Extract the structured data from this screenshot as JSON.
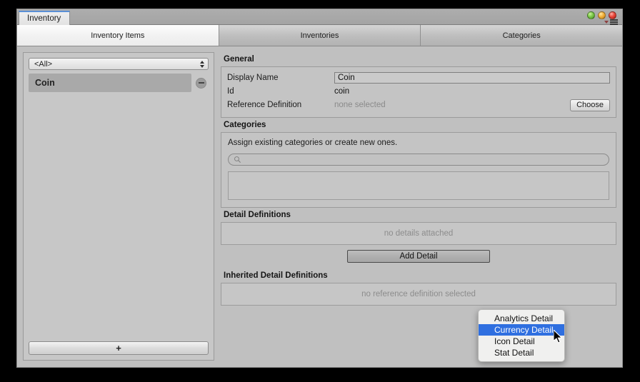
{
  "window": {
    "document_tab": "Inventory",
    "lights": [
      "green",
      "yellow",
      "red"
    ],
    "menu_icon": "hamburger-menu-icon"
  },
  "tabs": [
    {
      "label": "Inventory Items",
      "active": true
    },
    {
      "label": "Inventories",
      "active": false
    },
    {
      "label": "Categories",
      "active": false
    }
  ],
  "left_panel": {
    "filter": {
      "value": "<All>",
      "icon": "spin-arrows-icon"
    },
    "items": [
      {
        "label": "Coin",
        "selected": true,
        "remove_icon": "minus-circle-icon"
      }
    ],
    "add_button": "+"
  },
  "general": {
    "heading": "General",
    "display_name_label": "Display Name",
    "display_name_value": "Coin",
    "id_label": "Id",
    "id_value": "coin",
    "reference_definition_label": "Reference Definition",
    "reference_definition_value": "none selected",
    "choose_button": "Choose"
  },
  "categories": {
    "heading": "Categories",
    "hint": "Assign existing categories or create new ones.",
    "search_placeholder": "",
    "search_value": "",
    "search_icon": "search-icon",
    "assigned": []
  },
  "detail_definitions": {
    "heading": "Detail Definitions",
    "empty_text": "no details attached",
    "add_button": "Add Detail"
  },
  "inherited_detail_definitions": {
    "heading": "Inherited Detail Definitions",
    "empty_text": "no reference definition selected"
  },
  "popup_menu": {
    "items": [
      {
        "label": "Analytics Detail",
        "selected": false
      },
      {
        "label": "Currency Detail",
        "selected": true
      },
      {
        "label": "Icon Detail",
        "selected": false
      },
      {
        "label": "Stat Detail",
        "selected": false
      }
    ],
    "highlight_color": "#2f6fe0"
  },
  "colors": {
    "window_bg": "#c0c0c0",
    "panel_bg": "#c4c4c4",
    "selection_blue": "#2f6fe0",
    "muted_text": "#8a8a8a"
  }
}
